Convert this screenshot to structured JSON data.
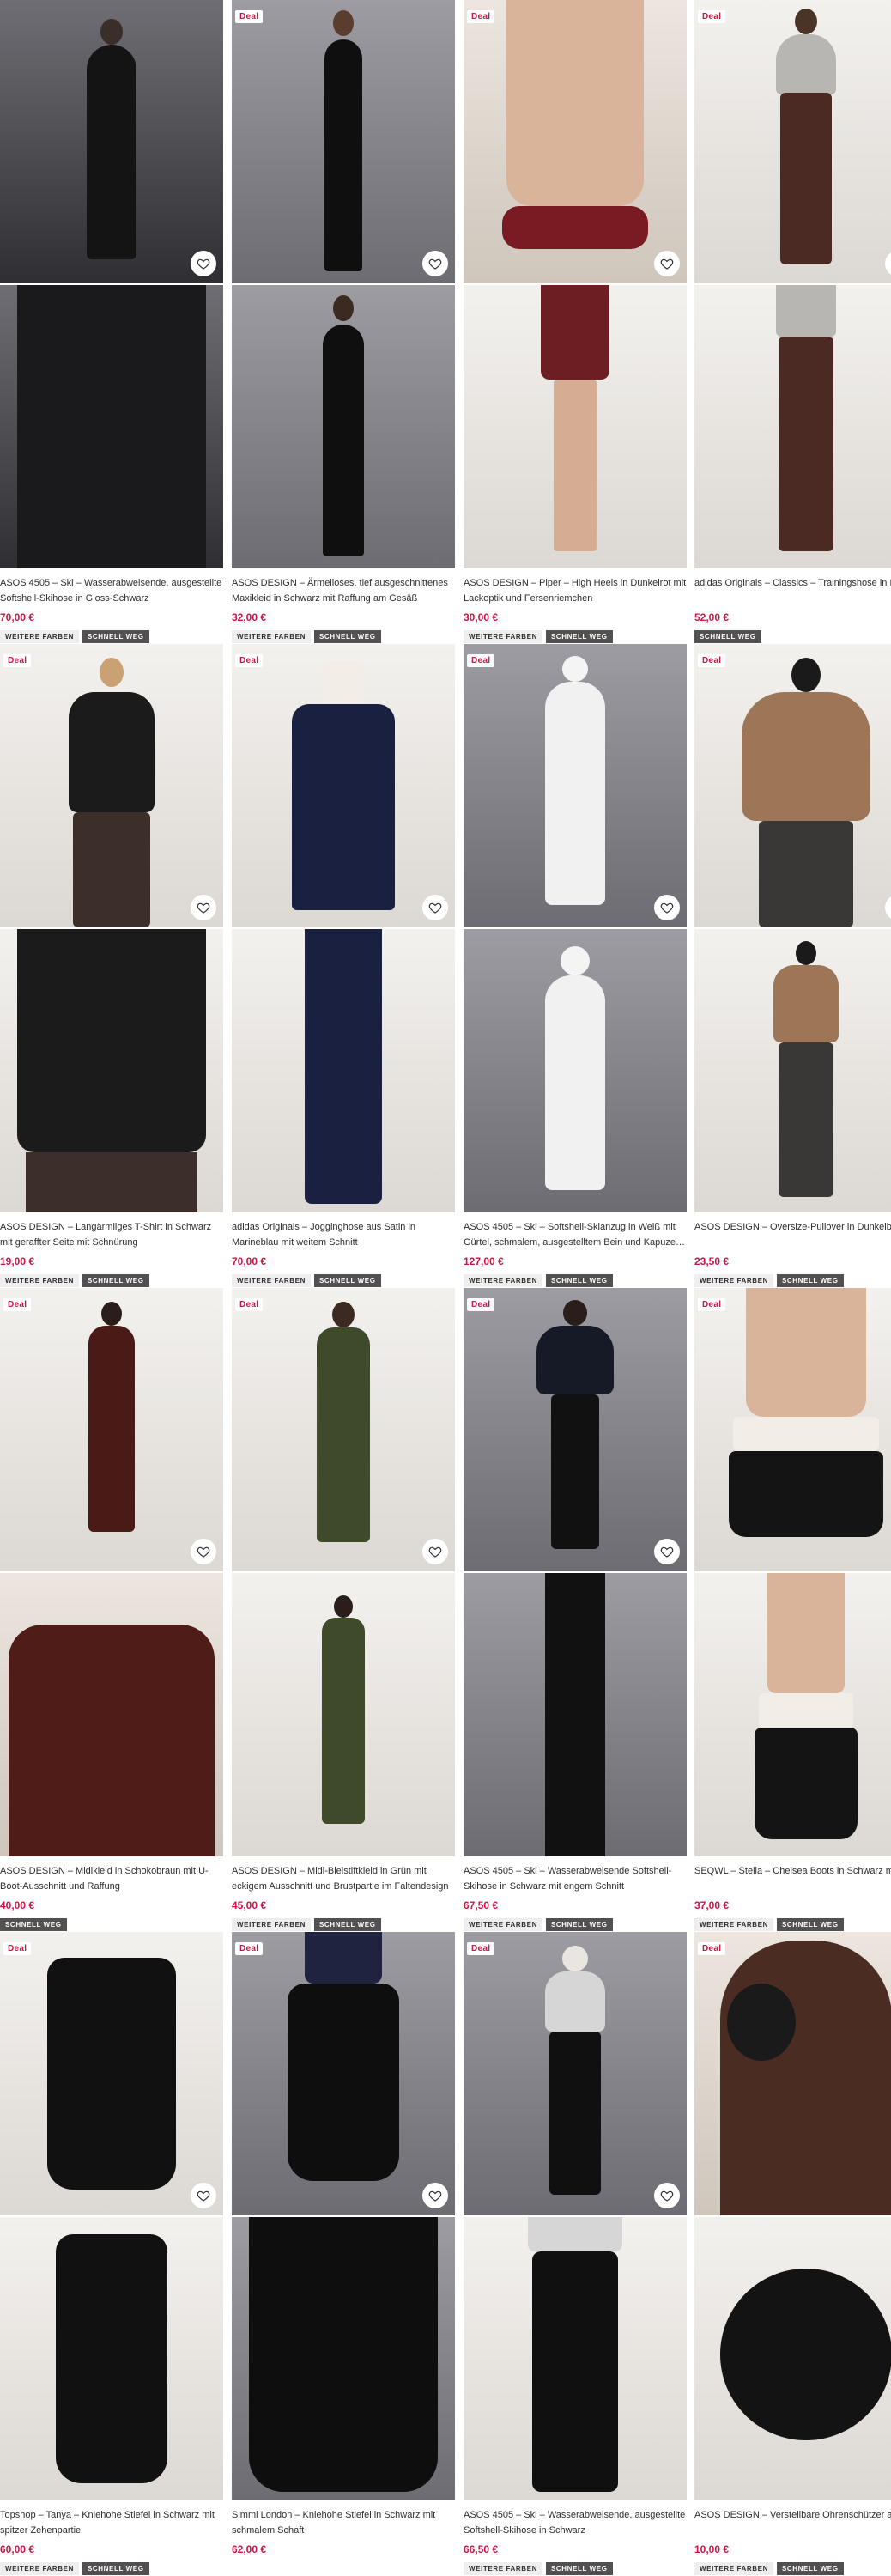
{
  "deal_label": "Deal",
  "tags": {
    "more_colors": "WEITERE FARBEN",
    "sell_fast": "SCHNELL WEG"
  },
  "products": [
    {
      "title": "ASOS 4505 – Ski – Wasserabweisende, ausgestellte Softshell-Skihose in Gloss-Schwarz",
      "price": "70,00 €",
      "deal": false,
      "more_colors": true,
      "sell_fast": true
    },
    {
      "title": "ASOS DESIGN – Ärmelloses, tief ausgeschnittenes Maxikleid in Schwarz mit Raffung am Gesäß",
      "price": "32,00 €",
      "deal": true,
      "more_colors": true,
      "sell_fast": true
    },
    {
      "title": "ASOS DESIGN – Piper – High Heels in Dunkelrot mit Lackoptik und Fersenriemchen",
      "price": "30,00 €",
      "deal": true,
      "more_colors": true,
      "sell_fast": true
    },
    {
      "title": "adidas Originals – Classics – Trainingshose in Braun und Rosa",
      "price": "52,00 €",
      "deal": true,
      "more_colors": false,
      "sell_fast": true
    },
    {
      "title": "ASOS DESIGN – Langärmliges T-Shirt in Schwarz mit geraffter Seite mit Schnürung",
      "price": "19,00 €",
      "deal": true,
      "more_colors": true,
      "sell_fast": true
    },
    {
      "title": "adidas Originals – Jogginghose aus Satin in Marineblau mit weitem Schnitt",
      "price": "70,00 €",
      "deal": true,
      "more_colors": true,
      "sell_fast": true
    },
    {
      "title": "ASOS 4505 – Ski – Softshell-Skianzug in Weiß mit Gürtel, schmalem, ausgestelltem Bein und Kapuze…",
      "price": "127,00 €",
      "deal": true,
      "more_colors": true,
      "sell_fast": true
    },
    {
      "title": "ASOS DESIGN – Oversize-Pullover in Dunkelbeige mit Rundhalsausschnitt und geschwungenem Saum",
      "price": "23,50 €",
      "deal": true,
      "more_colors": true,
      "sell_fast": true
    },
    {
      "title": "ASOS DESIGN – Midikleid in Schokobraun mit U-Boot-Ausschnitt und Raffung",
      "price": "40,00 €",
      "deal": true,
      "more_colors": false,
      "sell_fast": true
    },
    {
      "title": "ASOS DESIGN – Midi-Bleistiftkleid in Grün mit eckigem Ausschnitt und Brustpartie im Faltendesign",
      "price": "45,00 €",
      "deal": true,
      "more_colors": true,
      "sell_fast": true
    },
    {
      "title": "ASOS 4505 – Ski – Wasserabweisende Softshell-Skihose in Schwarz mit engem Schnitt",
      "price": "67,50 €",
      "deal": true,
      "more_colors": true,
      "sell_fast": true
    },
    {
      "title": "SEQWL – Stella – Chelsea Boots in Schwarz mit dicker Sohle",
      "price": "37,00 €",
      "deal": true,
      "more_colors": true,
      "sell_fast": true
    },
    {
      "title": "Topshop – Tanya – Kniehohe Stiefel in Schwarz mit spitzer Zehenpartie",
      "price": "60,00 €",
      "deal": true,
      "more_colors": true,
      "sell_fast": true
    },
    {
      "title": "Simmi London – Kniehohe Stiefel in Schwarz mit schmalem Schaft",
      "price": "62,00 €",
      "deal": true,
      "more_colors": false,
      "sell_fast": false
    },
    {
      "title": "ASOS 4505 – Ski – Wasserabweisende, ausgestellte Softshell-Skihose in Schwarz",
      "price": "66,50 €",
      "deal": true,
      "more_colors": true,
      "sell_fast": true
    },
    {
      "title": "ASOS DESIGN – Verstellbare Ohrenschützer aus Kunstpelz in Schwarz",
      "price": "10,00 €",
      "deal": true,
      "more_colors": true,
      "sell_fast": true
    }
  ]
}
